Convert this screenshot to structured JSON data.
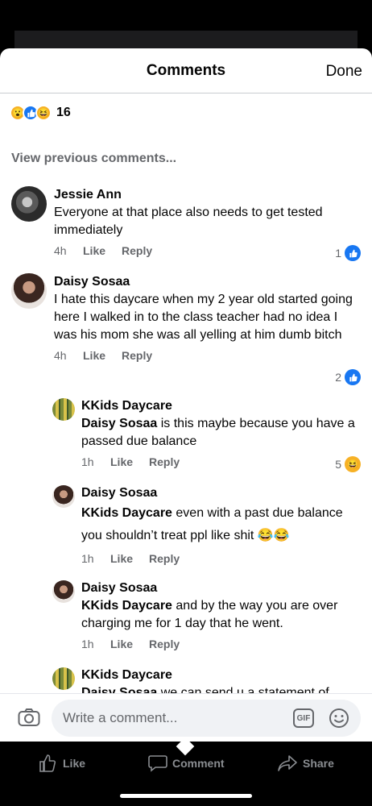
{
  "header": {
    "title": "Comments",
    "done_label": "Done"
  },
  "reactions": {
    "count": "16",
    "icons": [
      "wow-icon",
      "like-icon",
      "haha-icon"
    ]
  },
  "view_previous": "View previous comments...",
  "comments": [
    {
      "name": "Jessie Ann",
      "text": "Everyone at that place also needs to get tested immediately",
      "time": "4h",
      "like": "Like",
      "reply": "Reply",
      "reaction_count": "1",
      "reaction": "like-icon"
    },
    {
      "name": "Daisy Sosaa",
      "text": "I hate this daycare when my 2 year old started going here I walked in to the class teacher had no idea I was his mom she was all yelling at him dumb bitch",
      "time": "4h",
      "like": "Like",
      "reply": "Reply",
      "reaction_count": "2",
      "reaction": "like-icon"
    }
  ],
  "replies": [
    {
      "name": "KKids Daycare",
      "mention": "Daisy Sosaa",
      "text": " is this maybe because you have a passed due balance",
      "time": "1h",
      "like": "Like",
      "reply": "Reply",
      "reaction_count": "5",
      "reaction": "haha-icon"
    },
    {
      "name": "Daisy Sosaa",
      "mention": "KKids Daycare",
      "text": "  even with a past due balance you shouldn’t treat ppl like shit 😂😂",
      "time": "1h",
      "like": "Like",
      "reply": "Reply"
    },
    {
      "name": "Daisy Sosaa",
      "mention": "KKids Daycare",
      "text": " and by the way you are over charging me for 1 day that he went.",
      "time": "1h",
      "like": "Like",
      "reply": "Reply"
    },
    {
      "name": "KKids Daycare",
      "mention": "Daisy Sosaa",
      "text": " we can send u a statement   of"
    }
  ],
  "composer": {
    "placeholder": "Write a comment...",
    "gif_label": "GIF"
  },
  "bottom_bar": {
    "like": "Like",
    "comment": "Comment",
    "share": "Share"
  },
  "colors": {
    "accent": "#1877f2",
    "secondary_text": "#65676b",
    "reaction_yellow": "#f7b125"
  }
}
